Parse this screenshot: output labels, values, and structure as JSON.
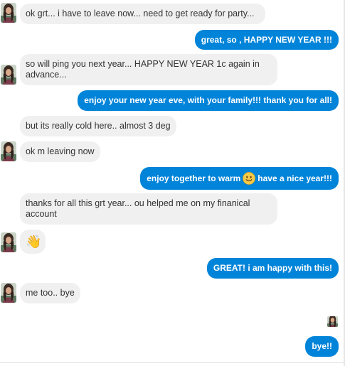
{
  "messages": [
    {
      "from": "them",
      "text": "ok grt... i have to leave now... need to get ready for party..."
    },
    {
      "from": "me",
      "text": "great, so , HAPPY NEW YEAR !!!"
    },
    {
      "from": "them",
      "text": "so will ping you next year... HAPPY NEW YEAR 1c again in advance..."
    },
    {
      "from": "me",
      "text": "enjoy your new year eve, with your family!!! thank you for all!"
    },
    {
      "from": "them",
      "text": "but its really cold here.. almost 3 deg"
    },
    {
      "from": "them",
      "text": "ok m leaving now"
    },
    {
      "from": "me",
      "text_before": "enjoy together to warm",
      "emoji": "slightly-smiling-face",
      "text_after": "have a nice year!!!"
    },
    {
      "from": "them",
      "text": "thanks for all this grt year... ou helped me on my finanical account"
    },
    {
      "from": "them",
      "emoji": "waving-hand",
      "glyph": "👋"
    },
    {
      "from": "me",
      "text": "GREAT! i am happy with this!"
    },
    {
      "from": "them",
      "text": "me too.. bye"
    },
    {
      "from": "me",
      "text": "bye!!"
    }
  ],
  "colors": {
    "outgoing_bubble": "#0084d9",
    "incoming_bubble": "#f0f0f0",
    "incoming_text": "#333333",
    "outgoing_text": "#ffffff"
  },
  "icons": {
    "avatar": "contact-avatar-photo",
    "seen_avatar": "seen-receipt-avatar"
  }
}
